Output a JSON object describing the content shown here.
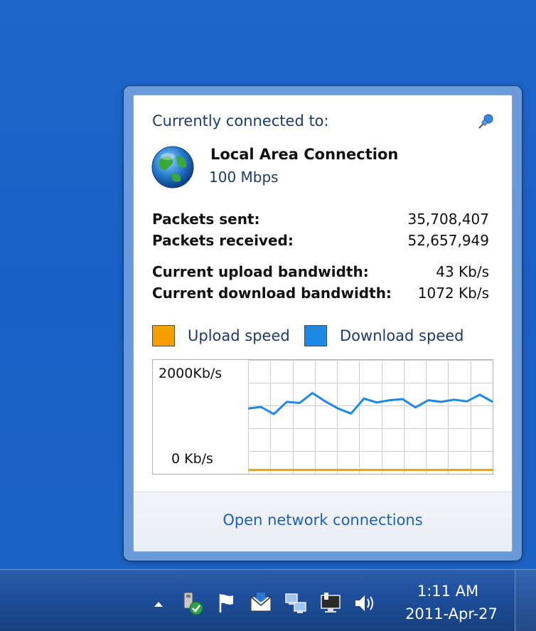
{
  "flyout": {
    "section_title": "Currently connected to:",
    "connection": {
      "name": "Local Area Connection",
      "speed": "100 Mbps"
    },
    "stats": [
      {
        "label": "Packets sent:",
        "value": "35,708,407"
      },
      {
        "label": "Packets received:",
        "value": "52,657,949"
      },
      {
        "label": "Current upload bandwidth:",
        "value": "43 Kb/s"
      },
      {
        "label": "Current download bandwidth:",
        "value": "1072 Kb/s"
      }
    ],
    "legend": {
      "upload_label": "Upload speed",
      "download_label": "Download speed",
      "upload_color": "#f5a000",
      "download_color": "#1e88e5"
    },
    "graph": {
      "ytop_label": "2000Kb/s",
      "ybottom_label": "0 Kb/s"
    },
    "footer_link": "Open network connections"
  },
  "chart_data": {
    "type": "line",
    "ylim": [
      0,
      2000
    ],
    "series": [
      {
        "name": "Download speed",
        "values": [
          1150,
          1180,
          1050,
          1270,
          1250,
          1430,
          1280,
          1150,
          1060,
          1330,
          1260,
          1300,
          1320,
          1170,
          1300,
          1270,
          1310,
          1280,
          1400,
          1270
        ]
      },
      {
        "name": "Upload speed",
        "values": [
          43,
          43,
          43,
          43,
          43,
          43,
          43,
          43,
          43,
          43,
          43,
          43,
          43,
          43,
          43,
          43,
          43,
          43,
          43,
          43
        ]
      }
    ],
    "title": "",
    "xlabel": "",
    "ylabel": ""
  },
  "taskbar": {
    "time": "1:11 AM",
    "date": "2011-Apr-27",
    "icons": [
      "show-hidden-icons-arrow",
      "safely-remove-hardware-icon",
      "action-center-flag-icon",
      "mail-icon",
      "network-icon",
      "display-icon",
      "volume-icon"
    ]
  }
}
